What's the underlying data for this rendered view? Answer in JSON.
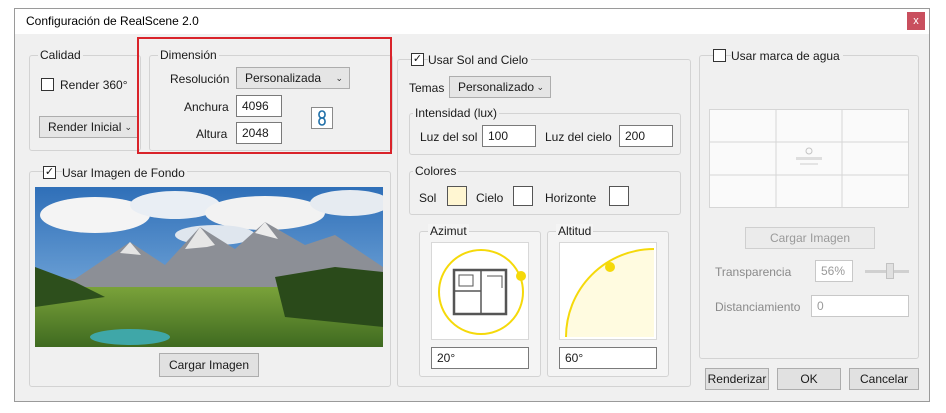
{
  "window": {
    "title": "Configuración de RealScene 2.0",
    "close_glyph": "x"
  },
  "calidad": {
    "legend": "Calidad",
    "render360_label": "Render 360°",
    "render360_checked": false,
    "render_mode_value": "Render Inicial"
  },
  "dimension": {
    "legend": "Dimensión",
    "resolucion_label": "Resolución",
    "resolucion_value": "Personalizada",
    "anchura_label": "Anchura",
    "anchura_value": "4096",
    "altura_label": "Altura",
    "altura_value": "2048",
    "link_icon": "chain-link-icon"
  },
  "fondo": {
    "checkbox_label": "Usar Imagen de Fondo",
    "checked": true,
    "load_button": "Cargar Imagen"
  },
  "sol_cielo": {
    "checkbox_label": "Usar Sol and Cielo",
    "checked": true,
    "temas_label": "Temas",
    "temas_value": "Personalizado",
    "intensidad_legend": "Intensidad (lux)",
    "luz_sol_label": "Luz del sol",
    "luz_sol_value": "100",
    "luz_cielo_label": "Luz del cielo",
    "luz_cielo_value": "200",
    "colores_legend": "Colores",
    "sol_label": "Sol",
    "cielo_label": "Cielo",
    "horizonte_label": "Horizonte",
    "sol_color": "#fff6d2",
    "cielo_color": "#ffffff",
    "horizonte_color": "#ffffff",
    "azimut_legend": "Azimut",
    "azimut_value": "20°",
    "altitud_legend": "Altitud",
    "altitud_value": "60°"
  },
  "marca_agua": {
    "checkbox_label": "Usar marca de agua",
    "checked": false,
    "load_button": "Cargar Imagen",
    "transparencia_label": "Transparencia",
    "transparencia_value": "56%",
    "transparencia_level": 0.56,
    "distanciamiento_label": "Distanciamiento",
    "distanciamiento_value": "0"
  },
  "footer": {
    "renderizar": "Renderizar",
    "ok": "OK",
    "cancelar": "Cancelar"
  },
  "colors": {
    "accent_highlight": "#d9232a",
    "sun_yellow": "#f5d90a"
  }
}
